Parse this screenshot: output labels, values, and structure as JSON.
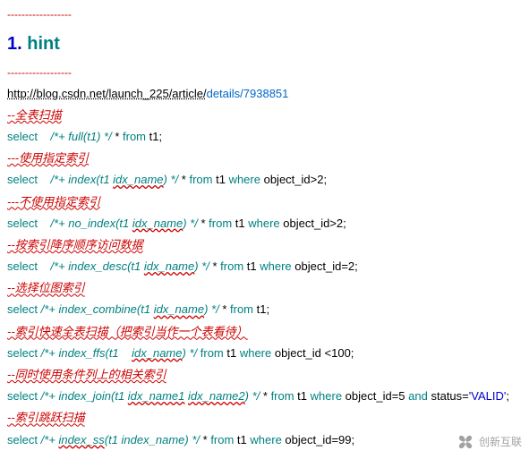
{
  "dash_top": "------------------",
  "heading_num": "1.",
  "heading_text": "hint",
  "dash_after_heading": "------------------",
  "url_a": "http://blog.csdn.net/launch_225/article/",
  "url_b": "details",
  "url_c": "/7938851",
  "comment1": "--全表扫描",
  "line1_a": "select",
  "line1_b_hint": "/*+ full(t1) */",
  "line1_c": "*",
  "line1_from": "from",
  "line1_t": " t1;",
  "comment2": "---使用指定索引",
  "line2_a": "select",
  "line2_b1": "/*+ index(t1 ",
  "line2_b2": "idx_name",
  "line2_b3": ") */",
  "line2_c": "*",
  "line2_from": "from",
  "line2_t": " t1 ",
  "line2_where": "where",
  "line2_cond": " object_id>2;",
  "comment3": "---不使用指定索引",
  "line3_a": "select",
  "line3_b1": "/*+ no_index(t1 ",
  "line3_b2": "idx_name",
  "line3_b3": ") */",
  "line3_c": "*",
  "line3_from": "from",
  "line3_t": " t1 ",
  "line3_where": "where",
  "line3_cond": " object_id>2;",
  "comment4": "--按索引降序顺序访问数据",
  "line4_a": "select",
  "line4_b1": "/*+ index_desc(t1 ",
  "line4_b2": "idx_name",
  "line4_b3": ") */",
  "line4_c": "*",
  "line4_from": "from",
  "line4_t": " t1 ",
  "line4_where": "where",
  "line4_cond": " object_id=2;",
  "comment5": "--选择位图索引",
  "line5_a": "select ",
  "line5_b1": "/*+ index_combine(t1 ",
  "line5_b2": "idx_name",
  "line5_b3": ") */",
  "line5_c": "*",
  "line5_from": "from",
  "line5_t": " t1;",
  "comment6": "--索引快速全表扫描（把索引当作一个表看待）",
  "line6_a": "select ",
  "line6_b1": "/*+ index_ffs(t1 ",
  "line6_b2": "idx_name",
  "line6_b3": ") */",
  "line6_from": "from",
  "line6_t": " t1 ",
  "line6_where": "where",
  "line6_cond": " object_id <100;",
  "comment7": "--同时使用条件列上的相关索引",
  "line7_a": "select ",
  "line7_b1": "/*+ index_join(t1 ",
  "line7_b2": "idx_name1",
  "line7_b2b": " ",
  "line7_b3": "idx_name2",
  "line7_b4": ") */",
  "line7_c": "*",
  "line7_from": "from",
  "line7_t": " t1 ",
  "line7_where": "where",
  "line7_cond": " object_id=5 ",
  "line7_and": "and",
  "line7_stat": " status=",
  "line7_val": "'VALID'",
  "line7_semi": ";",
  "comment8": "--索引跳跃扫描",
  "line8_a": "select ",
  "line8_b1": "/*+ ",
  "line8_b2": "index_ss",
  "line8_b3": "(t1 index_name) */",
  "line8_c": "*",
  "line8_from": "from",
  "line8_t": " t1 ",
  "line8_where": "where",
  "line8_cond": " object_id=99;",
  "watermark_text": "创新互联"
}
